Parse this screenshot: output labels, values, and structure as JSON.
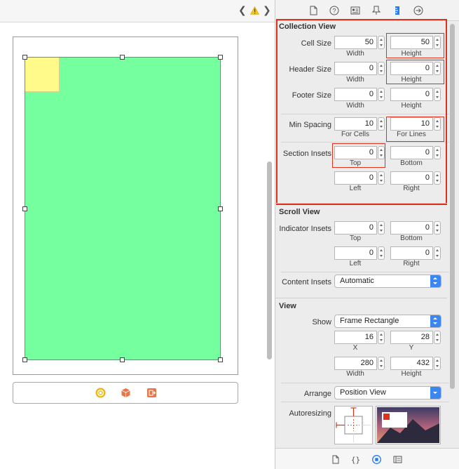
{
  "colors": {
    "accent": "#3b86f0",
    "highlight": "#e0301e",
    "collection_bg": "#75ff9f",
    "cell_bg": "#fffa8a"
  },
  "canvas": {
    "back_icon": "chevron-left-icon",
    "forward_icon": "chevron-right-icon",
    "warning_icon": "warning-icon",
    "back_glyph": "❮",
    "forward_glyph": "❯"
  },
  "scene_bar": {
    "icons": [
      "view-controller-icon",
      "first-responder-icon",
      "exit-icon"
    ]
  },
  "inspector": {
    "tabs": [
      "file-icon",
      "help-icon",
      "identity-icon",
      "attributes-icon",
      "size-icon",
      "connections-icon"
    ],
    "collection_view": {
      "title": "Collection View",
      "cell_size": {
        "label": "Cell Size",
        "width": "50",
        "width_label": "Width",
        "height": "50",
        "height_label": "Height"
      },
      "header_size": {
        "label": "Header Size",
        "width": "0",
        "width_label": "Width",
        "height": "0",
        "height_label": "Height"
      },
      "footer_size": {
        "label": "Footer Size",
        "width": "0",
        "width_label": "Width",
        "height": "0",
        "height_label": "Height"
      },
      "min_spacing": {
        "label": "Min Spacing",
        "cells": "10",
        "cells_label": "For Cells",
        "lines": "10",
        "lines_label": "For Lines"
      },
      "section_insets": {
        "label": "Section Insets",
        "top": "0",
        "top_label": "Top",
        "bottom": "0",
        "bottom_label": "Bottom",
        "left": "0",
        "left_label": "Left",
        "right": "0",
        "right_label": "Right"
      }
    },
    "scroll_view": {
      "title": "Scroll View",
      "indicator_insets": {
        "label": "Indicator Insets",
        "top": "0",
        "top_label": "Top",
        "bottom": "0",
        "bottom_label": "Bottom",
        "left": "0",
        "left_label": "Left",
        "right": "0",
        "right_label": "Right"
      },
      "content_insets": {
        "label": "Content Insets",
        "value": "Automatic"
      }
    },
    "view": {
      "title": "View",
      "show": {
        "label": "Show",
        "value": "Frame Rectangle"
      },
      "x": {
        "value": "16",
        "label": "X"
      },
      "y": {
        "value": "28",
        "label": "Y"
      },
      "width": {
        "value": "280",
        "label": "Width"
      },
      "height": {
        "value": "432",
        "label": "Height"
      },
      "arrange": {
        "label": "Arrange",
        "value": "Position View"
      },
      "autoresizing": {
        "label": "Autoresizing"
      }
    },
    "bottom_tabs": [
      "file-template-icon",
      "code-snippet-icon",
      "object-library-icon",
      "media-library-icon"
    ]
  }
}
